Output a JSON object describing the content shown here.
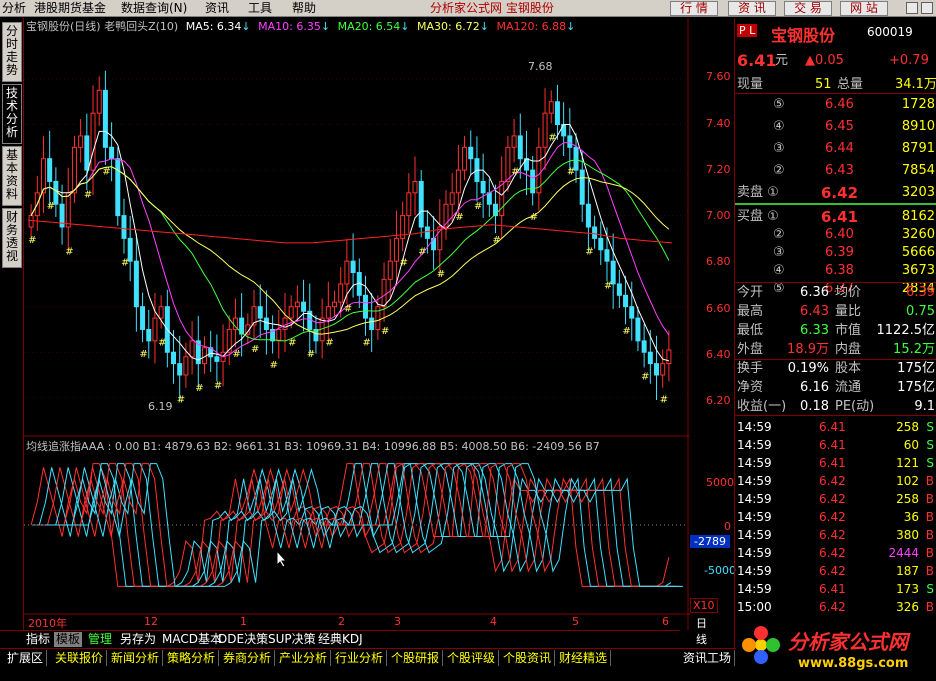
{
  "menu": {
    "items": [
      "分析",
      "港股期货基金",
      "数据查询(N)",
      "资讯",
      "工具",
      "帮助"
    ],
    "title": "分析家公式网  宝钢股份"
  },
  "topbuttons": [
    "行 情",
    "资 讯",
    "交 易",
    "网 站"
  ],
  "sidetabs": [
    "分时走势",
    "技术分析",
    "基本资料",
    "财务透视"
  ],
  "chart": {
    "header": {
      "name": "宝钢股份(日线) 老鸭回头Z(10)",
      "ma5": "MA5: 6.34",
      "ma10": "MA10: 6.35",
      "ma20": "MA20: 6.54",
      "ma30": "MA30: 6.72",
      "ma120": "MA120: 6.88"
    },
    "colors": {
      "ma5": "#ffffff",
      "ma10": "#ff40ff",
      "ma20": "#40ff40",
      "ma30": "#ffff60",
      "ma120": "#ff2020",
      "up": "#ff3030",
      "down": "#40e0ff"
    },
    "price_ticks": [
      "7.60",
      "7.40",
      "7.20",
      "7.00",
      "6.80",
      "6.60",
      "6.40",
      "6.20"
    ],
    "high_label": "7.68",
    "low_label": "6.19",
    "indicator_header": "均线追涨指AAA : 0.00  B1: 4879.63  B2: 9661.31  B3: 10969.31  B4: 10996.88  B5: 4008.50  B6: -2409.56  B7",
    "indicator_ticks": [
      "5000",
      "0",
      "-5000"
    ],
    "indicator_value": "-2789",
    "x_labels": [
      "2010年",
      "12",
      "1",
      "2",
      "3",
      "4",
      "5",
      "6"
    ],
    "zoom_label": "X10",
    "period_label": "日线"
  },
  "chart_data": {
    "type": "candlestick",
    "title": "宝钢股份(日线)",
    "ylim": [
      6.12,
      7.78
    ],
    "close_series": [
      7.0,
      7.1,
      7.25,
      7.15,
      7.05,
      6.95,
      7.1,
      7.3,
      7.35,
      7.2,
      7.45,
      7.55,
      7.3,
      7.25,
      7.0,
      6.9,
      6.8,
      6.6,
      6.5,
      6.45,
      6.55,
      6.6,
      6.4,
      6.35,
      6.3,
      6.38,
      6.45,
      6.35,
      6.42,
      6.38,
      6.36,
      6.4,
      6.5,
      6.55,
      6.48,
      6.52,
      6.6,
      6.55,
      6.5,
      6.45,
      6.5,
      6.55,
      6.6,
      6.62,
      6.58,
      6.5,
      6.45,
      6.55,
      6.6,
      6.62,
      6.7,
      6.8,
      6.75,
      6.65,
      6.55,
      6.5,
      6.6,
      6.72,
      6.8,
      6.9,
      7.0,
      7.1,
      7.15,
      6.95,
      6.9,
      6.85,
      6.95,
      7.05,
      7.1,
      7.2,
      7.3,
      7.25,
      7.15,
      7.1,
      7.05,
      7.0,
      7.15,
      7.3,
      7.35,
      7.25,
      7.2,
      7.1,
      7.3,
      7.45,
      7.5,
      7.4,
      7.35,
      7.3,
      7.2,
      7.05,
      6.95,
      6.9,
      6.85,
      6.8,
      6.7,
      6.65,
      6.6,
      6.55,
      6.45,
      6.4,
      6.35,
      6.3,
      6.35,
      6.41
    ],
    "ma120": [
      6.98,
      6.97,
      6.96,
      6.95,
      6.94,
      6.93,
      6.92,
      6.91,
      6.9,
      6.89,
      6.88,
      6.88,
      6.89,
      6.9,
      6.91,
      6.92,
      6.94,
      6.95,
      6.96,
      6.95,
      6.94,
      6.93,
      6.92,
      6.9,
      6.89,
      6.88
    ]
  },
  "quote": {
    "code_tag": "P L",
    "name": "宝钢股份",
    "code": "600019",
    "price": "6.41",
    "unit": "元",
    "change": "▲0.05",
    "pct": "+0.79",
    "vol_label": "现量",
    "vol": "51",
    "total_label": "总量",
    "total": "34.1万",
    "sell": [
      {
        "lv": "⑤",
        "p": "6.46",
        "v": "1728"
      },
      {
        "lv": "④",
        "p": "6.45",
        "v": "8910"
      },
      {
        "lv": "③",
        "p": "6.44",
        "v": "8791"
      },
      {
        "lv": "②",
        "p": "6.43",
        "v": "7854"
      },
      {
        "lv": "卖盘 ①",
        "p": "6.42",
        "v": "3203"
      }
    ],
    "buy": [
      {
        "lv": "买盘 ①",
        "p": "6.41",
        "v": "8162"
      },
      {
        "lv": "②",
        "p": "6.40",
        "v": "3260"
      },
      {
        "lv": "③",
        "p": "6.39",
        "v": "5666"
      },
      {
        "lv": "④",
        "p": "6.38",
        "v": "3673"
      },
      {
        "lv": "⑤",
        "p": "6.37",
        "v": "2834"
      }
    ],
    "stats": [
      {
        "l1": "今开",
        "v1": "6.36",
        "l2": "均价",
        "v2": "6.39",
        "c1": "#ffffff",
        "c2": "#ff3030"
      },
      {
        "l1": "最高",
        "v1": "6.43",
        "l2": "量比",
        "v2": "0.75",
        "c1": "#ff3030",
        "c2": "#40ff40"
      },
      {
        "l1": "最低",
        "v1": "6.33",
        "l2": "市值",
        "v2": "1122.5亿",
        "c1": "#40ff40",
        "c2": "#ffffff"
      },
      {
        "l1": "外盘",
        "v1": "18.9万",
        "l2": "内盘",
        "v2": "15.2万",
        "c1": "#ff3030",
        "c2": "#40ff40"
      },
      {
        "l1": "换手",
        "v1": "0.19%",
        "l2": "股本",
        "v2": "175亿",
        "c1": "#ffffff",
        "c2": "#ffffff"
      },
      {
        "l1": "净资",
        "v1": "6.16",
        "l2": "流通",
        "v2": "175亿",
        "c1": "#ffffff",
        "c2": "#ffffff"
      },
      {
        "l1": "收益(一)",
        "v1": "0.18",
        "l2": "PE(动)",
        "v2": "9.1",
        "c1": "#ffffff",
        "c2": "#ffffff"
      }
    ],
    "ticks": [
      {
        "t": "14:59",
        "p": "6.41",
        "v": "258",
        "d": "S",
        "pc": "#ff3030",
        "vc": "#ffff00",
        "dc": "#40ff40"
      },
      {
        "t": "14:59",
        "p": "6.41",
        "v": "60",
        "d": "S",
        "pc": "#ff3030",
        "vc": "#ffff00",
        "dc": "#40ff40"
      },
      {
        "t": "14:59",
        "p": "6.41",
        "v": "121",
        "d": "S",
        "pc": "#ff3030",
        "vc": "#ffff00",
        "dc": "#40ff40"
      },
      {
        "t": "14:59",
        "p": "6.42",
        "v": "102",
        "d": "B",
        "pc": "#ff3030",
        "vc": "#ffff00",
        "dc": "#ff3030"
      },
      {
        "t": "14:59",
        "p": "6.42",
        "v": "258",
        "d": "B",
        "pc": "#ff3030",
        "vc": "#ffff00",
        "dc": "#ff3030"
      },
      {
        "t": "14:59",
        "p": "6.42",
        "v": "36",
        "d": "B",
        "pc": "#ff3030",
        "vc": "#ffff00",
        "dc": "#ff3030"
      },
      {
        "t": "14:59",
        "p": "6.42",
        "v": "380",
        "d": "B",
        "pc": "#ff3030",
        "vc": "#ffff00",
        "dc": "#ff3030"
      },
      {
        "t": "14:59",
        "p": "6.42",
        "v": "2444",
        "d": "B",
        "pc": "#ff3030",
        "vc": "#ff40ff",
        "dc": "#ff3030"
      },
      {
        "t": "14:59",
        "p": "6.42",
        "v": "187",
        "d": "B",
        "pc": "#ff3030",
        "vc": "#ffff00",
        "dc": "#ff3030"
      },
      {
        "t": "14:59",
        "p": "6.41",
        "v": "173",
        "d": "S",
        "pc": "#ff3030",
        "vc": "#ffff00",
        "dc": "#40ff40"
      },
      {
        "t": "15:00",
        "p": "6.42",
        "v": "326",
        "d": "B",
        "pc": "#ff3030",
        "vc": "#ffff00",
        "dc": "#ff3030"
      },
      {
        "t": "15:00",
        "p": "6.41",
        "v": "51",
        "d": "S",
        "pc": "#ff3030",
        "vc": "#ffff00",
        "dc": "#40ff40"
      }
    ]
  },
  "bottom1": [
    "指标",
    "模板",
    "管理",
    "另存为",
    "MACD基本",
    "DDE决策",
    "SUP决策",
    "经典KDJ"
  ],
  "bottom2": [
    "扩展区",
    "关联报价",
    "新闻分析",
    "策略分析",
    "券商分析",
    "产业分析",
    "行业分析",
    "个股研报",
    "个股评级",
    "个股资讯",
    "财经精选"
  ],
  "bottom2_right": "资讯工场",
  "logo": {
    "title": "分析家公式网",
    "url": "www.88gs.com"
  }
}
